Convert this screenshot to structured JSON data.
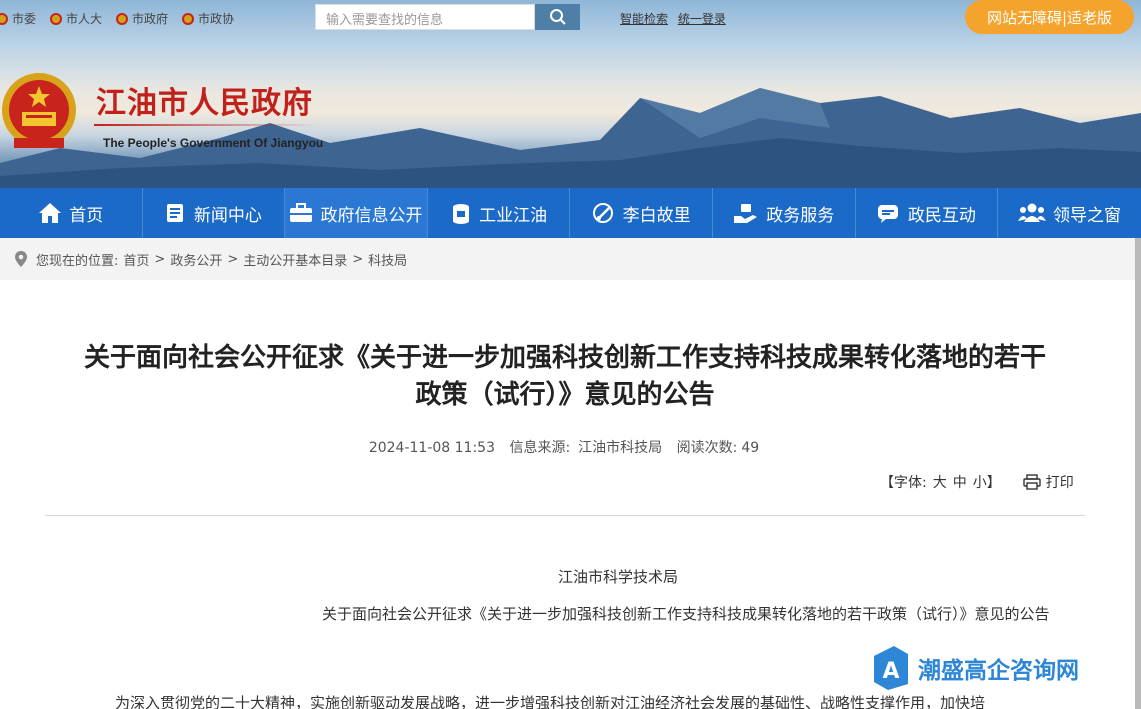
{
  "topbar": {
    "links": [
      "市委",
      "市人大",
      "市政府",
      "市政协"
    ],
    "search_placeholder": "输入需要查找的信息",
    "right_links": [
      "智能检索",
      "统一登录"
    ],
    "access_button": "网站无障碍|适老版"
  },
  "header": {
    "title": "江油市人民政府",
    "subtitle": "The People's Government Of Jiangyou"
  },
  "nav": {
    "items": [
      {
        "label": "首页",
        "icon": "home-icon"
      },
      {
        "label": "新闻中心",
        "icon": "newspaper-icon"
      },
      {
        "label": "政府信息公开",
        "icon": "briefcase-icon"
      },
      {
        "label": "工业江油",
        "icon": "factory-icon"
      },
      {
        "label": "李白故里",
        "icon": "brush-icon"
      },
      {
        "label": "政务服务",
        "icon": "service-icon"
      },
      {
        "label": "政民互动",
        "icon": "chat-icon"
      },
      {
        "label": "领导之窗",
        "icon": "people-icon"
      }
    ],
    "active_index": 2
  },
  "breadcrumb": {
    "prefix": "您现在的位置:",
    "items": [
      "首页",
      "政务公开",
      "主动公开基本目录",
      "科技局"
    ],
    "separator": ">"
  },
  "article": {
    "title_line1": "关于面向社会公开征求《关于进一步加强科技创新工作支持科技成果转化落地的若干",
    "title_line2": "政策（试行）》意见的公告",
    "date": "2024-11-08 11:53",
    "source_label": "信息来源:",
    "source": "江油市科技局",
    "reads_label": "阅读次数:",
    "reads": "49",
    "font_label": "【字体:",
    "font_sizes": [
      "大",
      "中",
      "小"
    ],
    "font_close": "】",
    "print_label": "打印",
    "org": "江油市科学技术局",
    "body_title": "关于面向社会公开征求《关于进一步加强科技创新工作支持科技成果转化落地的若干政策（试行）》意见的公告",
    "body_first": "为深入贯彻党的二十大精神，实施创新驱动发展战略，进一步增强科技创新对江油经济社会发展的基础性、战略性支撑作用，加快培"
  },
  "watermark": {
    "text": "潮盛高企咨询网",
    "badge_letter": "A"
  },
  "colors": {
    "nav_bg": "#1c6ac7",
    "title_red": "#c1201b",
    "access_orange": "#f4a32d",
    "watermark_blue": "#2d86d6"
  }
}
